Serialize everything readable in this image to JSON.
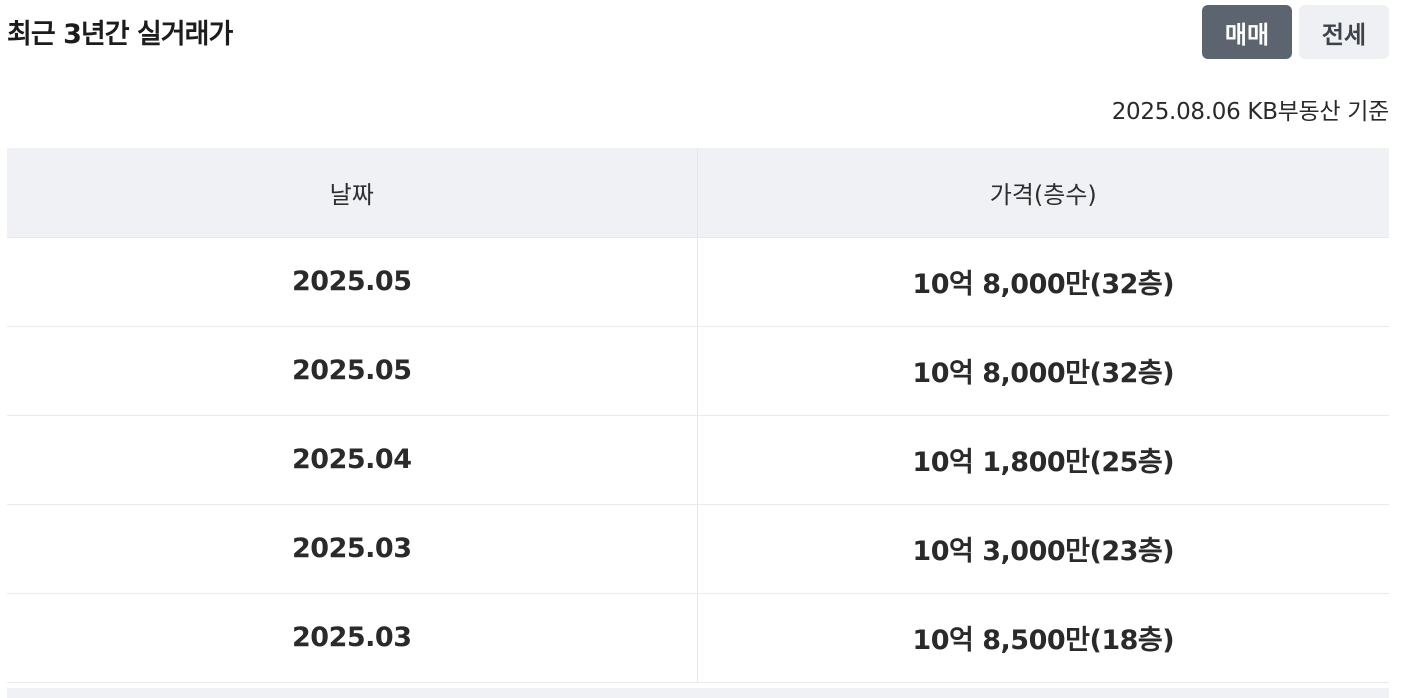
{
  "section": {
    "title": "최근 3년간 실거래가",
    "basis_text": "2025.08.06 KB부동산 기준"
  },
  "tabs": [
    {
      "label": "매매",
      "active": true
    },
    {
      "label": "전세",
      "active": false
    }
  ],
  "table": {
    "headers": {
      "date": "날짜",
      "price": "가격(층수)"
    },
    "rows": [
      {
        "date": "2025.05",
        "price": "10억 8,000만(32층)"
      },
      {
        "date": "2025.05",
        "price": "10억 8,000만(32층)"
      },
      {
        "date": "2025.04",
        "price": "10억 1,800만(25층)"
      },
      {
        "date": "2025.03",
        "price": "10억 3,000만(23층)"
      },
      {
        "date": "2025.03",
        "price": "10억 8,500만(18층)"
      }
    ]
  },
  "colors": {
    "active_tab_bg": "#5c6470",
    "inactive_tab_bg": "#eff0f3",
    "header_bg": "#f0f1f4"
  }
}
